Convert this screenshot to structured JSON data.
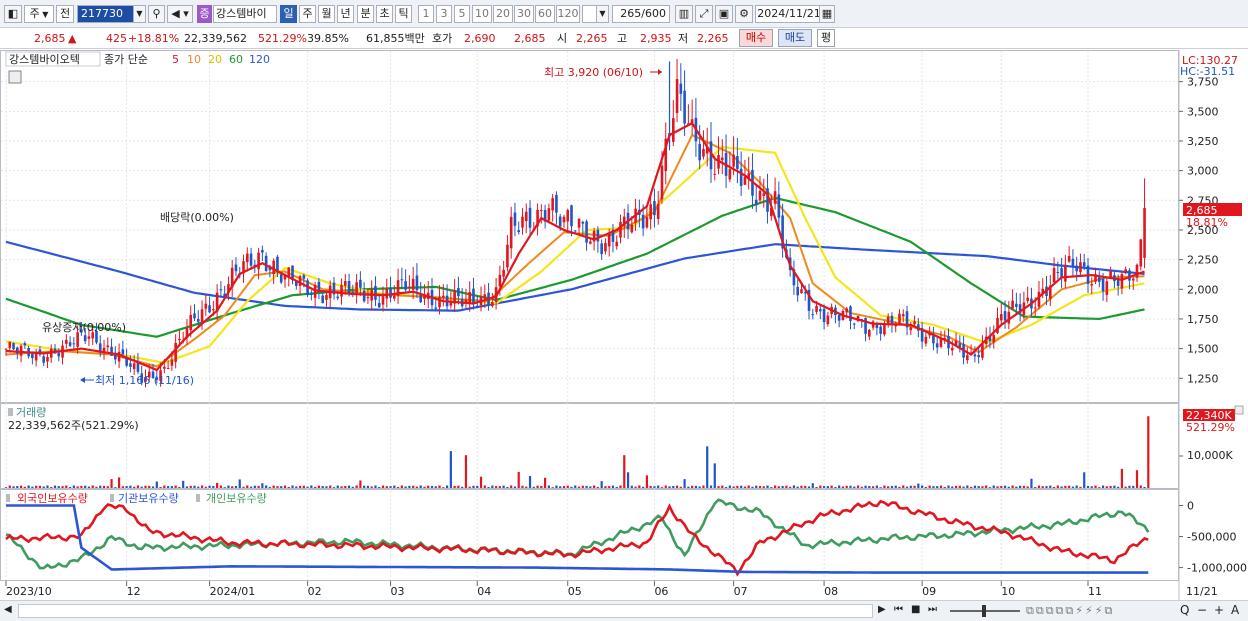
{
  "toolbar": {
    "period_type": "주",
    "prev_label": "전",
    "stock_code": "217730",
    "stock_badge": "증",
    "stock_name": "강스템바이",
    "period_tabs": [
      "일",
      "주",
      "월",
      "년",
      "분",
      "초",
      "틱"
    ],
    "active_tab": "일",
    "intervals": [
      "1",
      "3",
      "5",
      "10",
      "20",
      "30",
      "60",
      "120"
    ],
    "count": "265",
    "count_total": "/600",
    "date": "2024/11/21"
  },
  "quote": {
    "price": "2,685",
    "change_arrow": "▲",
    "change": "425",
    "change_pct": "+18.81%",
    "volume": "22,339,562",
    "volume_pct": "521.29%",
    "turnover_pct": "39.85%",
    "amount": "61,855백만",
    "hoga_label": "호가",
    "hoga1": "2,690",
    "hoga2": "2,685",
    "open_label": "시",
    "open": "2,265",
    "high_label": "고",
    "high": "2,935",
    "low_label": "저",
    "low": "2,265",
    "buy_label": "매수",
    "sell_label": "매도",
    "avg_label": "평"
  },
  "colors": {
    "up": "#e0171f",
    "down": "#1f55c7",
    "ma5": "#e0171f",
    "ma10": "#f0891c",
    "ma20": "#f5e51a",
    "ma60": "#1d9a2e",
    "ma120": "#2d56d6",
    "foreign": "#2d56d6",
    "institution": "#e0171f",
    "individual": "#3f9b5e"
  },
  "chart_data": [
    {
      "type": "candlestick",
      "title": "강스템바이오텍",
      "legend": {
        "price_label": "종가 단순",
        "ma": [
          "5",
          "10",
          "20",
          "60",
          "120"
        ]
      },
      "y_ticks": [
        3750,
        3500,
        3250,
        3000,
        2750,
        2500,
        2250,
        2000,
        1750,
        1500,
        1250
      ],
      "ylim": [
        1050,
        4000
      ],
      "lc_label": "LC:130.27",
      "hc_label": "HC:-31.51",
      "current_price_label": "2,685",
      "current_pct_label": "18.81%",
      "annotations": {
        "high": "최고 3,920 (06/10)",
        "low": "최저 1,166 (11/16)",
        "dividend": "배당락(0.00%)",
        "rights": "유상증자(0.00%)"
      },
      "x_labels": [
        "2023/10",
        "12",
        "2024/01",
        "02",
        "03",
        "04",
        "05",
        "06",
        "07",
        "08",
        "09",
        "10",
        "11",
        "11/21"
      ],
      "price_path": [
        [
          0,
          1500
        ],
        [
          8,
          1440
        ],
        [
          16,
          1510
        ],
        [
          22,
          1620
        ],
        [
          30,
          1430
        ],
        [
          36,
          1250
        ],
        [
          42,
          1330
        ],
        [
          50,
          1750
        ],
        [
          56,
          1950
        ],
        [
          62,
          2150
        ],
        [
          68,
          2300
        ],
        [
          74,
          2100
        ],
        [
          80,
          2000
        ],
        [
          90,
          1980
        ],
        [
          100,
          1950
        ],
        [
          106,
          2020
        ],
        [
          112,
          1940
        ],
        [
          122,
          1880
        ],
        [
          130,
          1980
        ],
        [
          134,
          2480
        ],
        [
          140,
          2600
        ],
        [
          144,
          2750
        ],
        [
          148,
          2550
        ],
        [
          154,
          2480
        ],
        [
          160,
          2400
        ],
        [
          166,
          2550
        ],
        [
          172,
          2700
        ],
        [
          176,
          3350
        ],
        [
          178,
          3600
        ],
        [
          182,
          3300
        ],
        [
          188,
          3100
        ],
        [
          194,
          2950
        ],
        [
          198,
          2850
        ],
        [
          204,
          2750
        ],
        [
          208,
          2050
        ],
        [
          214,
          1850
        ],
        [
          220,
          1780
        ],
        [
          228,
          1700
        ],
        [
          238,
          1720
        ],
        [
          248,
          1560
        ],
        [
          256,
          1420
        ],
        [
          264,
          1750
        ],
        [
          272,
          1900
        ],
        [
          278,
          2100
        ],
        [
          284,
          2200
        ],
        [
          290,
          2080
        ],
        [
          296,
          2050
        ],
        [
          300,
          2150
        ],
        [
          302,
          2685
        ]
      ],
      "ma5": [
        [
          0,
          1480
        ],
        [
          10,
          1460
        ],
        [
          20,
          1500
        ],
        [
          30,
          1450
        ],
        [
          40,
          1320
        ],
        [
          48,
          1600
        ],
        [
          56,
          1820
        ],
        [
          62,
          2130
        ],
        [
          68,
          2220
        ],
        [
          74,
          2120
        ],
        [
          82,
          1990
        ],
        [
          92,
          1960
        ],
        [
          100,
          1950
        ],
        [
          108,
          1980
        ],
        [
          116,
          1900
        ],
        [
          124,
          1880
        ],
        [
          130,
          1940
        ],
        [
          136,
          2300
        ],
        [
          142,
          2600
        ],
        [
          148,
          2500
        ],
        [
          156,
          2420
        ],
        [
          162,
          2500
        ],
        [
          170,
          2700
        ],
        [
          176,
          3300
        ],
        [
          182,
          3400
        ],
        [
          188,
          3100
        ],
        [
          196,
          2960
        ],
        [
          202,
          2800
        ],
        [
          208,
          2200
        ],
        [
          214,
          1900
        ],
        [
          222,
          1780
        ],
        [
          230,
          1710
        ],
        [
          240,
          1700
        ],
        [
          250,
          1560
        ],
        [
          256,
          1450
        ],
        [
          264,
          1700
        ],
        [
          272,
          1880
        ],
        [
          280,
          2100
        ],
        [
          288,
          2120
        ],
        [
          296,
          2080
        ],
        [
          302,
          2150
        ]
      ],
      "ma10": [
        [
          0,
          1450
        ],
        [
          14,
          1480
        ],
        [
          28,
          1450
        ],
        [
          40,
          1350
        ],
        [
          50,
          1580
        ],
        [
          58,
          1780
        ],
        [
          66,
          2120
        ],
        [
          74,
          2150
        ],
        [
          84,
          2000
        ],
        [
          98,
          1960
        ],
        [
          114,
          1930
        ],
        [
          128,
          1900
        ],
        [
          138,
          2200
        ],
        [
          148,
          2480
        ],
        [
          160,
          2450
        ],
        [
          172,
          2650
        ],
        [
          182,
          3300
        ],
        [
          192,
          3150
        ],
        [
          200,
          2900
        ],
        [
          208,
          2600
        ],
        [
          214,
          2050
        ],
        [
          224,
          1800
        ],
        [
          236,
          1720
        ],
        [
          250,
          1600
        ],
        [
          258,
          1470
        ],
        [
          268,
          1680
        ],
        [
          280,
          2000
        ],
        [
          292,
          2100
        ],
        [
          302,
          2110
        ]
      ],
      "ma20": [
        [
          0,
          1560
        ],
        [
          16,
          1480
        ],
        [
          32,
          1440
        ],
        [
          42,
          1380
        ],
        [
          54,
          1520
        ],
        [
          64,
          1900
        ],
        [
          74,
          2180
        ],
        [
          86,
          2050
        ],
        [
          100,
          1960
        ],
        [
          116,
          1930
        ],
        [
          130,
          1880
        ],
        [
          142,
          2150
        ],
        [
          154,
          2500
        ],
        [
          166,
          2520
        ],
        [
          178,
          2850
        ],
        [
          190,
          3200
        ],
        [
          204,
          3150
        ],
        [
          212,
          2600
        ],
        [
          220,
          2100
        ],
        [
          232,
          1780
        ],
        [
          246,
          1700
        ],
        [
          260,
          1550
        ],
        [
          272,
          1700
        ],
        [
          286,
          1950
        ],
        [
          302,
          2050
        ]
      ],
      "ma60": [
        [
          0,
          1920
        ],
        [
          20,
          1700
        ],
        [
          40,
          1600
        ],
        [
          60,
          1800
        ],
        [
          76,
          1950
        ],
        [
          94,
          2000
        ],
        [
          114,
          2020
        ],
        [
          130,
          1910
        ],
        [
          150,
          2080
        ],
        [
          170,
          2300
        ],
        [
          190,
          2620
        ],
        [
          204,
          2770
        ],
        [
          220,
          2650
        ],
        [
          240,
          2400
        ],
        [
          256,
          2050
        ],
        [
          270,
          1770
        ],
        [
          290,
          1750
        ],
        [
          302,
          1830
        ]
      ],
      "ma120": [
        [
          0,
          2400
        ],
        [
          30,
          2150
        ],
        [
          50,
          1970
        ],
        [
          74,
          1860
        ],
        [
          94,
          1830
        ],
        [
          120,
          1820
        ],
        [
          150,
          2000
        ],
        [
          180,
          2260
        ],
        [
          204,
          2380
        ],
        [
          230,
          2330
        ],
        [
          260,
          2280
        ],
        [
          280,
          2200
        ],
        [
          302,
          2130
        ]
      ]
    },
    {
      "type": "bar",
      "title": "거래량",
      "value_label": "22,339,562주(521.29%)",
      "last_label": "22,340K",
      "last_pct": "521.29%",
      "y_tick": "10,000K",
      "ylim": [
        0,
        24000
      ],
      "spikes": [
        [
          28,
          2600
        ],
        [
          30,
          3100
        ],
        [
          40,
          1900
        ],
        [
          47,
          2100
        ],
        [
          56,
          1500
        ],
        [
          62,
          2500
        ],
        [
          68,
          1400
        ],
        [
          94,
          2200
        ],
        [
          118,
          10800
        ],
        [
          122,
          9600
        ],
        [
          126,
          3300
        ],
        [
          136,
          4700
        ],
        [
          139,
          3500
        ],
        [
          143,
          3000
        ],
        [
          158,
          2000
        ],
        [
          164,
          9600
        ],
        [
          165,
          4600
        ],
        [
          170,
          3700
        ],
        [
          180,
          2600
        ],
        [
          186,
          12200
        ],
        [
          188,
          7200
        ],
        [
          214,
          1400
        ],
        [
          242,
          1300
        ],
        [
          272,
          2700
        ],
        [
          286,
          4600
        ],
        [
          296,
          5600
        ],
        [
          300,
          5200
        ],
        [
          303,
          21000
        ]
      ]
    },
    {
      "type": "line",
      "title": "holdings",
      "series_names": [
        "외국인보유수량",
        "기관보유수량",
        "개인보유수량"
      ],
      "y_ticks": [
        0,
        -500000,
        -1000000
      ],
      "y_tick_labels": [
        "0",
        "-500,000",
        "-1,000,000"
      ],
      "ylim": [
        -1200000,
        250000
      ],
      "foreign": [
        [
          0,
          0
        ],
        [
          18,
          0
        ],
        [
          20,
          -680000
        ],
        [
          28,
          -1030000
        ],
        [
          60,
          -980000
        ],
        [
          100,
          -990000
        ],
        [
          140,
          -1000000
        ],
        [
          176,
          -1030000
        ],
        [
          196,
          -1070000
        ],
        [
          230,
          -1080000
        ],
        [
          280,
          -1080000
        ],
        [
          303,
          -1080000
        ]
      ],
      "institution": [
        [
          0,
          -540000
        ],
        [
          20,
          -500000
        ],
        [
          26,
          -10000
        ],
        [
          32,
          -50000
        ],
        [
          38,
          -420000
        ],
        [
          60,
          -600000
        ],
        [
          90,
          -640000
        ],
        [
          118,
          -700000
        ],
        [
          150,
          -790000
        ],
        [
          170,
          -600000
        ],
        [
          176,
          -30000
        ],
        [
          182,
          -480000
        ],
        [
          194,
          -1060000
        ],
        [
          200,
          -600000
        ],
        [
          216,
          -170000
        ],
        [
          232,
          60000
        ],
        [
          252,
          -270000
        ],
        [
          266,
          -450000
        ],
        [
          280,
          -730000
        ],
        [
          294,
          -880000
        ],
        [
          303,
          -500000
        ]
      ],
      "individual": [
        [
          0,
          -470000
        ],
        [
          10,
          -1030000
        ],
        [
          20,
          -860000
        ],
        [
          28,
          -520000
        ],
        [
          36,
          -680000
        ],
        [
          60,
          -640000
        ],
        [
          90,
          -580000
        ],
        [
          118,
          -690000
        ],
        [
          150,
          -780000
        ],
        [
          174,
          -200000
        ],
        [
          180,
          -820000
        ],
        [
          188,
          70000
        ],
        [
          200,
          -110000
        ],
        [
          212,
          -640000
        ],
        [
          236,
          -520000
        ],
        [
          252,
          -470000
        ],
        [
          280,
          -300000
        ],
        [
          296,
          -100000
        ],
        [
          303,
          -380000
        ]
      ]
    }
  ],
  "statusbar": {
    "nav_buttons": [
      "▶",
      "⏮",
      "■",
      "⏭"
    ],
    "tools": [
      "Q",
      "−",
      "+",
      "A"
    ]
  }
}
